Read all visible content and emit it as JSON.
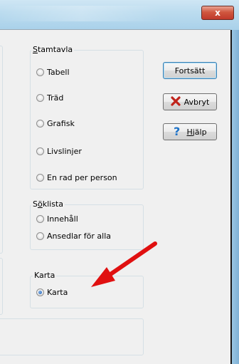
{
  "window": {
    "close_label": "x"
  },
  "groups": {
    "stamtavla": {
      "label_first": "S",
      "label_rest": "tamtavla",
      "options": [
        {
          "label": "Tabell",
          "checked": false
        },
        {
          "label": "Träd",
          "checked": false
        },
        {
          "label": "Grafisk",
          "checked": false
        },
        {
          "label": "Livslinjer",
          "checked": false
        },
        {
          "label": "En rad per person",
          "checked": false
        }
      ]
    },
    "soklista": {
      "label_prefix": "S",
      "label_underlined": "ö",
      "label_rest": "klista",
      "options": [
        {
          "label": "Innehåll",
          "checked": false
        },
        {
          "label": "Ansedlar för alla",
          "checked": false
        }
      ]
    },
    "karta": {
      "label": "Karta",
      "options": [
        {
          "label": "Karta",
          "checked": true
        }
      ]
    }
  },
  "buttons": {
    "continue_label": "Fortsätt",
    "cancel_label": "Avbryt",
    "help_prefix": "",
    "help_underlined": "H",
    "help_rest": "jälp"
  },
  "colors": {
    "arrow": "#e01010",
    "cancel_icon": "#c0231b",
    "help_icon": "#1e73c8",
    "close_button": "#c0392b"
  },
  "icons": {
    "cancel": "red-x-icon",
    "help": "blue-question-icon",
    "annotation": "red-arrow"
  }
}
